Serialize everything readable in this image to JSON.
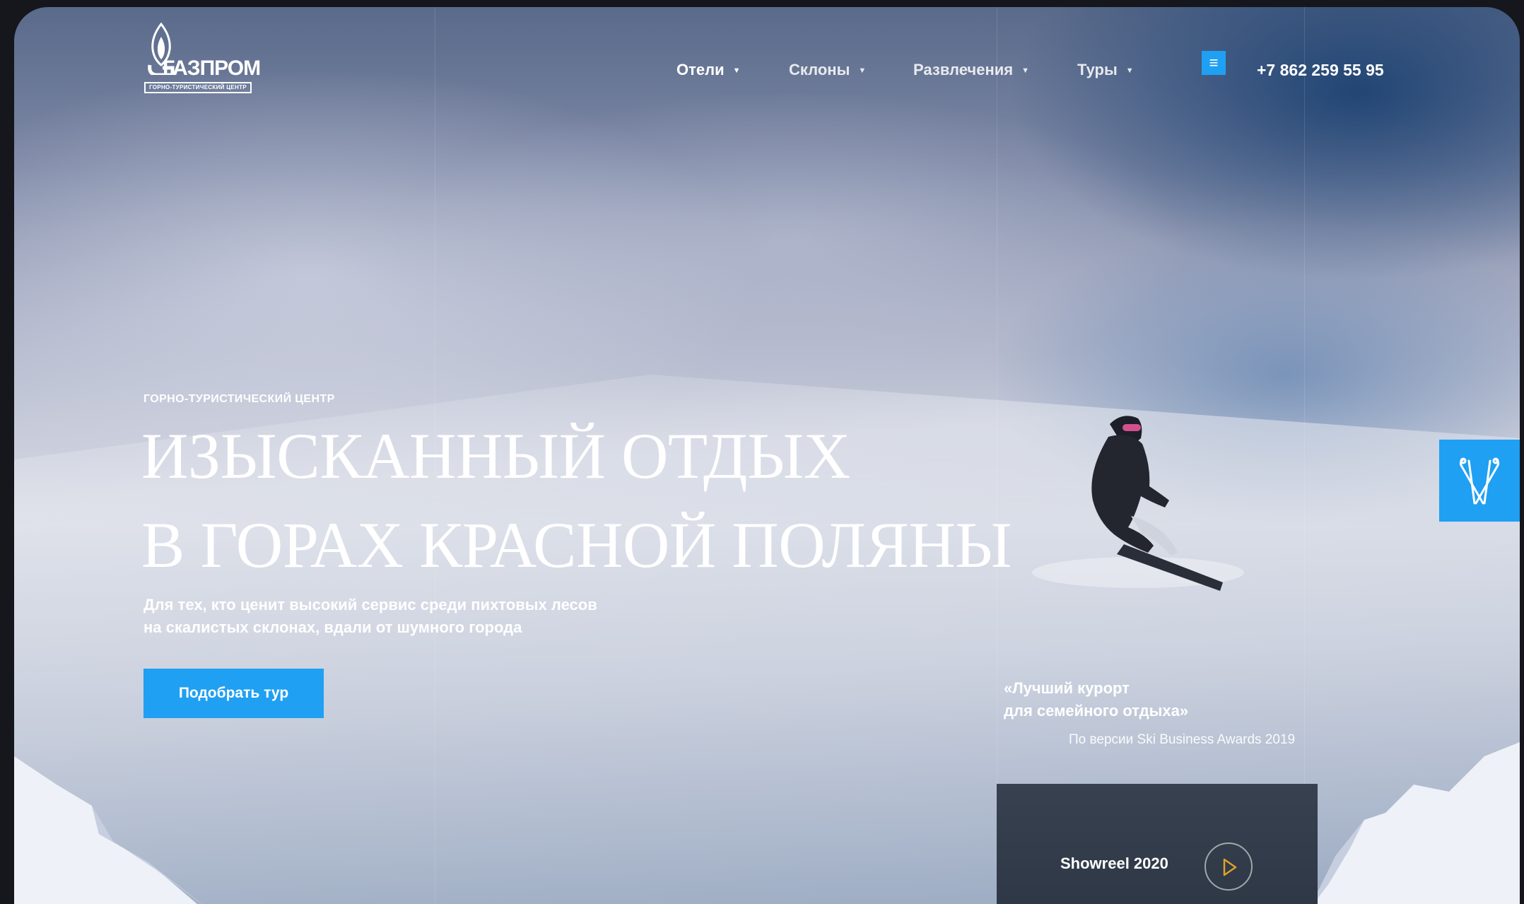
{
  "header": {
    "logo_text": "ГАЗПРОМ",
    "logo_sub": "ГОРНО-ТУРИСТИЧЕСКИЙ ЦЕНТР",
    "nav": [
      {
        "label": "Отели",
        "active": true
      },
      {
        "label": "Склоны",
        "active": false
      },
      {
        "label": "Развлечения",
        "active": false
      },
      {
        "label": "Туры",
        "active": false
      }
    ],
    "phone": "+7 862 259 55 95"
  },
  "hero": {
    "eyebrow": "ГОРНО-ТУРИСТИЧЕСКИЙ ЦЕНТР",
    "headline_line1": "ИЗЫСКАННЫЙ ОТДЫХ",
    "headline_line2": "В ГОРАХ КРАСНОЙ ПОЛЯНЫ",
    "subtext_line1": "Для тех, кто ценит высокий сервис среди пихтовых лесов",
    "subtext_line2": "на скалистых склонах, вдали от шумного города",
    "cta_label": "Подобрать тур"
  },
  "award": {
    "quote_line1": "«Лучший курорт",
    "quote_line2": "для семейного отдыха»",
    "source": "По версии Ski Business Awards 2019"
  },
  "showreel": {
    "label": "Showreel 2020"
  },
  "colors": {
    "accent": "#1fa0f2",
    "play_icon": "#e0a12a",
    "showreel_bg": "#323c4a"
  },
  "icons": {
    "menu": "hamburger-icon",
    "play": "play-icon",
    "side_widget": "ski-poles-icon",
    "nav_caret": "caret-down-icon"
  }
}
